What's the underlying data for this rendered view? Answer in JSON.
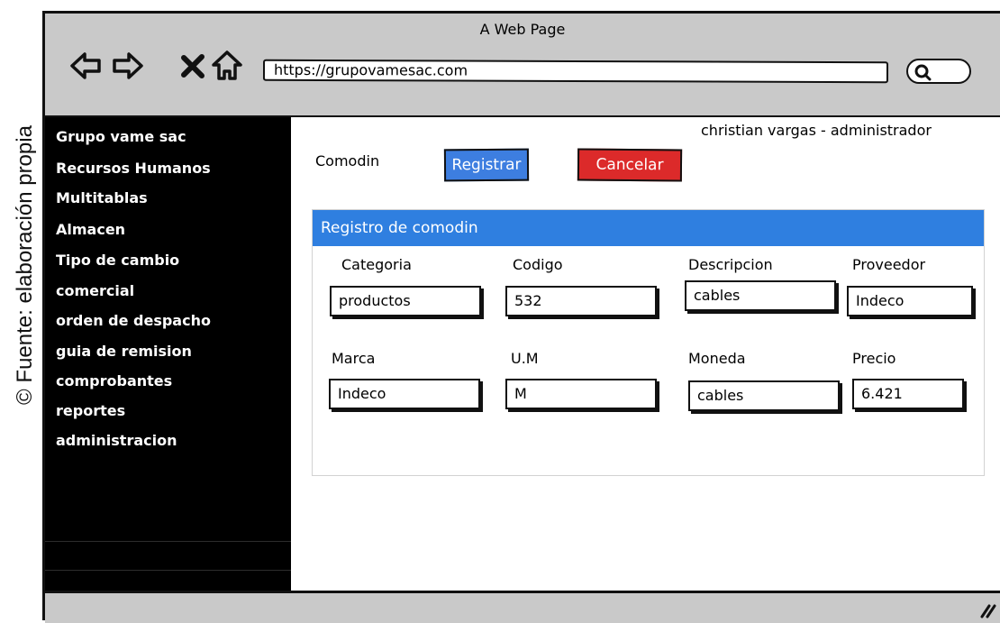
{
  "caption": "© Fuente: elaboración propia",
  "browser": {
    "title": "A Web Page",
    "url": "https://grupovamesac.com",
    "icons": [
      "back-arrow-icon",
      "forward-arrow-icon",
      "close-icon",
      "home-icon",
      "search-icon",
      "resize-grip-icon"
    ]
  },
  "sidebar": {
    "items": [
      {
        "label": "Grupo vame sac"
      },
      {
        "label": "Recursos Humanos"
      },
      {
        "label": "Multitablas"
      },
      {
        "label": "Almacen"
      },
      {
        "label": "Tipo de cambio"
      },
      {
        "label": "comercial"
      },
      {
        "label": "orden de despacho"
      },
      {
        "label": "guia de remision"
      },
      {
        "label": "comprobantes"
      },
      {
        "label": "reportes"
      },
      {
        "label": "administracion"
      }
    ]
  },
  "header": {
    "user": "christian vargas - administrador",
    "page_label": "Comodin",
    "register_button": "Registrar",
    "cancel_button": "Cancelar"
  },
  "panel": {
    "title": "Registro de comodin",
    "fields": [
      {
        "label": "Categoria",
        "value": "productos"
      },
      {
        "label": "Codigo",
        "value": "532"
      },
      {
        "label": "Descripcion",
        "value": "cables"
      },
      {
        "label": "Proveedor",
        "value": "Indeco"
      },
      {
        "label": "Marca",
        "value": "Indeco"
      },
      {
        "label": "U.M",
        "value": "M"
      },
      {
        "label": "Moneda",
        "value": "cables"
      },
      {
        "label": "Precio",
        "value": "6.421"
      }
    ]
  },
  "colors": {
    "sidebar": "#000000",
    "chrome": "#c9c9c9",
    "primary_button": "#3d7ee0",
    "danger_button": "#dc2a2a",
    "panel_header": "#2f7fe0"
  }
}
